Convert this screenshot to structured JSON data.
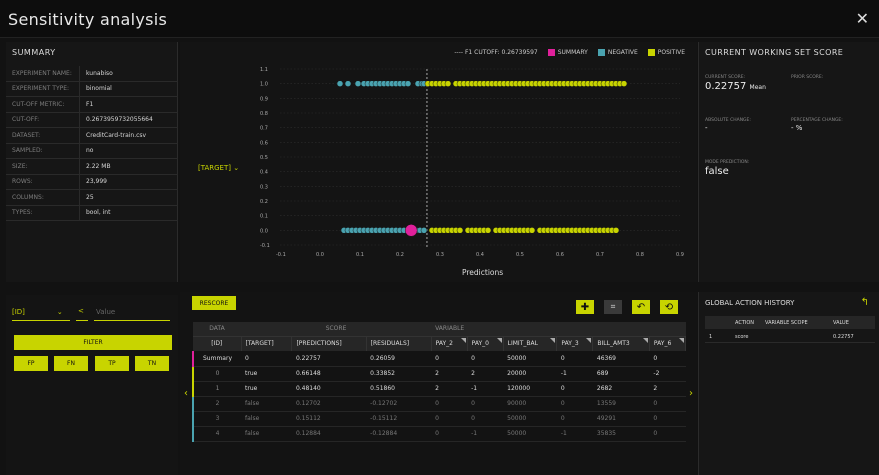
{
  "app": {
    "title": "Sensitivity analysis",
    "close_icon": "close-icon"
  },
  "summary": {
    "title": "SUMMARY",
    "rows": [
      {
        "k": "EXPERIMENT NAME:",
        "v": "kunabiso"
      },
      {
        "k": "EXPERIMENT TYPE:",
        "v": "binomial"
      },
      {
        "k": "CUT-OFF METRIC:",
        "v": "F1"
      },
      {
        "k": "CUT-OFF:",
        "v": "0.2673959732055664"
      },
      {
        "k": "DATASET:",
        "v": "CreditCard-train.csv"
      },
      {
        "k": "SAMPLED:",
        "v": "no"
      },
      {
        "k": "SIZE:",
        "v": "2.22 MB"
      },
      {
        "k": "ROWS:",
        "v": "23,999"
      },
      {
        "k": "COLUMNS:",
        "v": "25"
      },
      {
        "k": "TYPES:",
        "v": "bool, int"
      }
    ]
  },
  "chart": {
    "legend_cutoff": "F1 CUTOFF: 0.26739597",
    "legend_summary": "SUMMARY",
    "legend_negative": "NEGATIVE",
    "legend_positive": "POSITIVE",
    "target_select": "[TARGET]",
    "xlabel": "Predictions"
  },
  "chart_data": {
    "type": "scatter",
    "title": "",
    "xlabel": "Predictions",
    "ylabel": "[TARGET]",
    "xlim": [
      -0.1,
      0.9
    ],
    "ylim": [
      -0.1,
      1.1
    ],
    "xticks": [
      "-0.1",
      "0.0",
      "0.1",
      "0.2",
      "0.3",
      "0.4",
      "0.5",
      "0.6",
      "0.7",
      "0.8",
      "0.9"
    ],
    "yticks": [
      "-0.1",
      "0.0",
      "0.1",
      "0.2",
      "0.3",
      "0.4",
      "0.5",
      "0.6",
      "0.7",
      "0.8",
      "0.9",
      "1.0",
      "1.1"
    ],
    "cutoff": 0.26739597,
    "colors": {
      "summary": "#e0209b",
      "negative": "#4aa3b0",
      "positive": "#c8d400"
    },
    "series": [
      {
        "name": "NEGATIVE",
        "y": 1.0,
        "x": [
          0.05,
          0.07,
          0.095,
          0.11,
          0.12,
          0.13,
          0.14,
          0.15,
          0.16,
          0.17,
          0.18,
          0.19,
          0.2,
          0.21,
          0.22,
          0.245,
          0.255,
          0.26
        ]
      },
      {
        "name": "POSITIVE",
        "y": 1.0,
        "x": [
          0.27,
          0.28,
          0.29,
          0.3,
          0.31,
          0.32,
          0.34,
          0.35,
          0.36,
          0.37,
          0.38,
          0.39,
          0.4,
          0.41,
          0.42,
          0.43,
          0.44,
          0.45,
          0.46,
          0.47,
          0.48,
          0.49,
          0.5,
          0.51,
          0.52,
          0.53,
          0.54,
          0.55,
          0.56,
          0.57,
          0.58,
          0.59,
          0.6,
          0.61,
          0.62,
          0.63,
          0.64,
          0.65,
          0.66,
          0.67,
          0.68,
          0.69,
          0.7,
          0.71,
          0.72,
          0.73,
          0.74,
          0.75,
          0.76
        ]
      },
      {
        "name": "NEGATIVE",
        "y": 0.0,
        "x": [
          0.06,
          0.07,
          0.08,
          0.09,
          0.1,
          0.11,
          0.12,
          0.13,
          0.14,
          0.15,
          0.16,
          0.17,
          0.18,
          0.19,
          0.2,
          0.21,
          0.24,
          0.25,
          0.26
        ]
      },
      {
        "name": "POSITIVE",
        "y": 0.0,
        "x": [
          0.28,
          0.29,
          0.3,
          0.31,
          0.32,
          0.33,
          0.34,
          0.35,
          0.37,
          0.38,
          0.39,
          0.4,
          0.41,
          0.42,
          0.44,
          0.45,
          0.46,
          0.47,
          0.48,
          0.49,
          0.5,
          0.51,
          0.52,
          0.53,
          0.55,
          0.56,
          0.57,
          0.58,
          0.59,
          0.6,
          0.61,
          0.62,
          0.63,
          0.64,
          0.65,
          0.66,
          0.67,
          0.68,
          0.69,
          0.7,
          0.71,
          0.72,
          0.73,
          0.74
        ]
      },
      {
        "name": "SUMMARY",
        "y": 0.0,
        "x": [
          0.228
        ]
      }
    ]
  },
  "current_score": {
    "title": "CURRENT WORKING SET SCORE",
    "current_label": "CURRENT SCORE:",
    "current_value": "0.22757",
    "current_unit": "Mean",
    "prior_label": "PRIOR SCORE:",
    "abs_label": "ABSOLUTE CHANGE:",
    "abs_value": "-",
    "pct_label": "PERCENTAGE CHANGE:",
    "pct_value": "- %",
    "mode_label": "MODE PREDICTION:",
    "mode_value": "false"
  },
  "filters": {
    "id_select": "[ID]",
    "op_select": "<",
    "value_placeholder": "Value",
    "filter_button": "FILTER",
    "fp": "FP",
    "fn": "FN",
    "tp": "TP",
    "tn": "TN"
  },
  "table": {
    "rescore_button": "RESCORE",
    "group_headers": {
      "data": "DATA",
      "score": "SCORE",
      "variable": "VARIABLE"
    },
    "columns": [
      "[ID]",
      "[TARGET]",
      "[PREDICTIONS]",
      "[RESIDUALS]",
      "PAY_2",
      "PAY_0",
      "LIMIT_BAL",
      "PAY_3",
      "BILL_AMT3",
      "PAY_6"
    ],
    "rows": [
      {
        "c": [
          "Summary",
          "0",
          "0.22757",
          "0.26059",
          "0",
          "0",
          "50000",
          "0",
          "46369",
          "0"
        ]
      },
      {
        "c": [
          "0",
          "true",
          "0.66148",
          "0.33852",
          "2",
          "2",
          "20000",
          "-1",
          "689",
          "-2"
        ]
      },
      {
        "c": [
          "1",
          "true",
          "0.48140",
          "0.51860",
          "2",
          "-1",
          "120000",
          "0",
          "2682",
          "2"
        ]
      },
      {
        "c": [
          "2",
          "false",
          "0.12702",
          "-0.12702",
          "0",
          "0",
          "90000",
          "0",
          "13559",
          "0"
        ]
      },
      {
        "c": [
          "3",
          "false",
          "0.15112",
          "-0.15112",
          "0",
          "0",
          "50000",
          "0",
          "49291",
          "0"
        ]
      },
      {
        "c": [
          "4",
          "false",
          "0.12884",
          "-0.12884",
          "0",
          "-1",
          "50000",
          "-1",
          "35835",
          "0"
        ]
      }
    ],
    "tools": [
      "plus-icon",
      "grid-icon",
      "undo-icon",
      "reset-icon"
    ]
  },
  "history": {
    "title": "GLOBAL ACTION HISTORY",
    "headers": [
      "ACTION",
      "VARIABLE SCOPE",
      "VALUE"
    ],
    "rows": [
      {
        "n": "1",
        "action": "score",
        "scope": "",
        "value": "0.22757"
      }
    ]
  }
}
